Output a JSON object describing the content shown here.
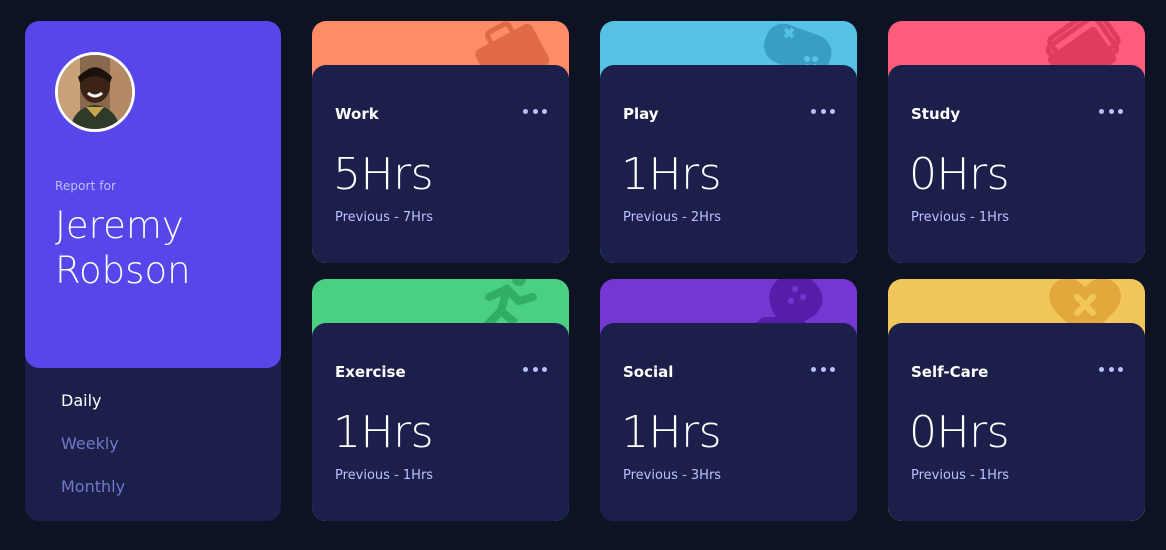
{
  "profile": {
    "report_label": "Report for",
    "first_name": "Jeremy",
    "last_name": "Robson",
    "accent_color": "#5746ea"
  },
  "timeframes": [
    {
      "label": "Daily",
      "active": true
    },
    {
      "label": "Weekly",
      "active": false
    },
    {
      "label": "Monthly",
      "active": false
    }
  ],
  "activities": [
    {
      "title": "Work",
      "current": "5Hrs",
      "previous": "Previous - 7Hrs",
      "color": "#ff8c66",
      "icon": "briefcase-icon"
    },
    {
      "title": "Play",
      "current": "1Hrs",
      "previous": "Previous - 2Hrs",
      "color": "#56c2e6",
      "icon": "gamepad-icon"
    },
    {
      "title": "Study",
      "current": "0Hrs",
      "previous": "Previous - 1Hrs",
      "color": "#ff5c7c",
      "icon": "book-icon"
    },
    {
      "title": "Exercise",
      "current": "1Hrs",
      "previous": "Previous - 1Hrs",
      "color": "#4bcf83",
      "icon": "running-icon"
    },
    {
      "title": "Social",
      "current": "1Hrs",
      "previous": "Previous - 3Hrs",
      "color": "#7536d3",
      "icon": "chat-icon"
    },
    {
      "title": "Self-Care",
      "current": "0Hrs",
      "previous": "Previous - 1Hrs",
      "color": "#f1c75b",
      "icon": "heart-icon"
    }
  ]
}
